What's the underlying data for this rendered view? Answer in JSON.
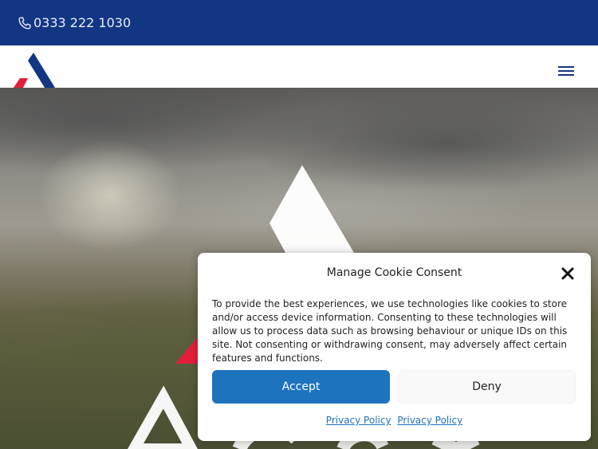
{
  "topbar": {
    "phone_icon": "phone-icon",
    "phone_number": "0333 222 1030"
  },
  "navbar": {
    "logo": "company-logo",
    "menu_icon": "hamburger-menu-icon"
  },
  "cookie_consent": {
    "title": "Manage Cookie Consent",
    "close_icon": "close-icon",
    "body": "To provide the best experiences, we use technologies like cookies to store and/or access device information. Consenting to these technologies will allow us to process data such as browsing behaviour or unique IDs on this site. Not consenting or withdrawing consent, may adversely affect certain features and functions.",
    "accept_label": "Accept",
    "deny_label": "Deny",
    "policy_links": [
      "Privacy Policy",
      "Privacy Policy"
    ]
  },
  "colors": {
    "brand_blue": "#133684",
    "brand_red": "#e31e3c",
    "accept_blue": "#1e73be"
  }
}
